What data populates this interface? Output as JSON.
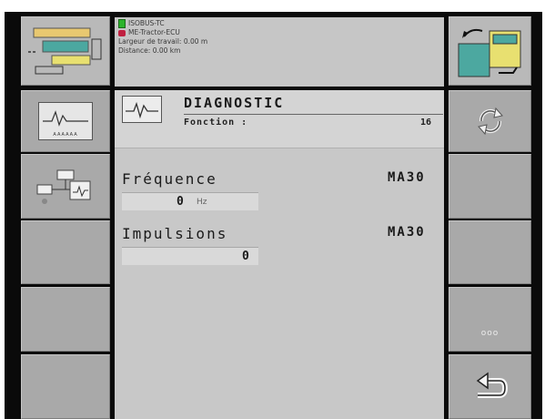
{
  "info": {
    "line1": "ISOBUS-TC",
    "line2": "ME-Tractor-ECU",
    "line3": "Largeur de travail: 0.00 m",
    "line4": "Distance: 0.00 km"
  },
  "header": {
    "title": "DIAGNOSTIC",
    "subtitle": "Fonction :",
    "function_number": "16"
  },
  "freq": {
    "label": "Fréquence",
    "code": "MA30",
    "value": "0",
    "unit": "Hz"
  },
  "impulses": {
    "label": "Impulsions",
    "code": "MA30",
    "value": "0"
  },
  "softkeys_left": [
    {
      "icon": "task-map-icon"
    },
    {
      "icon": "diagnostic-signal-icon",
      "label": "AAAAAA"
    },
    {
      "icon": "network-diagnostic-icon"
    },
    {
      "icon": "empty"
    },
    {
      "icon": "empty"
    },
    {
      "icon": "empty"
    }
  ],
  "softkeys_right": [
    {
      "icon": "task-switch-icon"
    },
    {
      "icon": "refresh-icon"
    },
    {
      "icon": "empty"
    },
    {
      "icon": "empty"
    },
    {
      "icon": "more-icon",
      "label": "ooo"
    },
    {
      "icon": "return-icon"
    }
  ]
}
